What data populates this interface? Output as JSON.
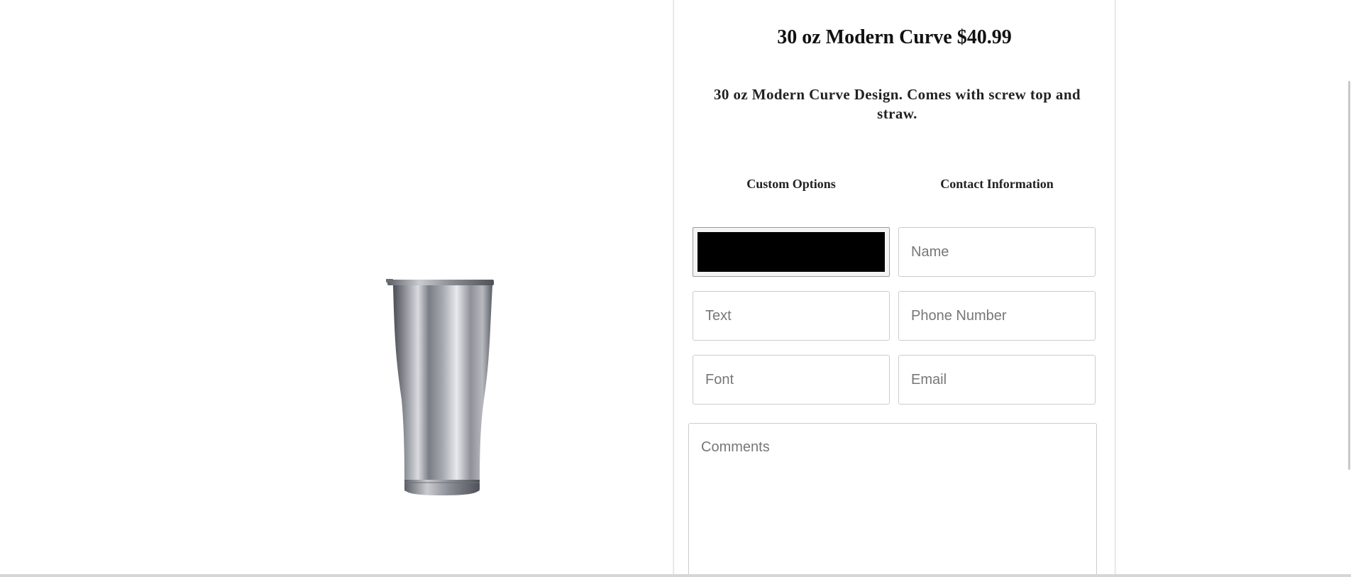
{
  "product": {
    "title": "30 oz Modern Curve $40.99",
    "description": "30 oz Modern Curve Design. Comes with screw top and straw.",
    "image_icon": "tumbler-image"
  },
  "form": {
    "custom_options_heading": "Custom Options",
    "contact_information_heading": "Contact Information",
    "color_value": "#000000",
    "text_placeholder": "Text",
    "font_placeholder": "Font",
    "name_placeholder": "Name",
    "phone_placeholder": "Phone Number",
    "email_placeholder": "Email",
    "comments_placeholder": "Comments"
  }
}
